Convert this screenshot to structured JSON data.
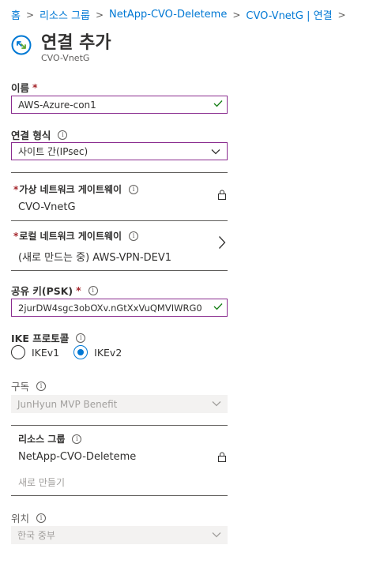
{
  "breadcrumb": [
    "홈",
    "리소스 그룹",
    "NetApp-CVO-Deleteme",
    "CVO-VnetG | 연결"
  ],
  "header": {
    "title": "연결 추가",
    "subtitle": "CVO-VnetG"
  },
  "form": {
    "name": {
      "label": "이름",
      "value": "AWS-Azure-con1"
    },
    "connection_type": {
      "label": "연결 형식",
      "value": "사이트 간(IPsec)"
    },
    "virtual_gateway": {
      "label": "가상 네트워크 게이트웨이",
      "value": "CVO-VnetG"
    },
    "local_gateway": {
      "label": "로컬 네트워크 게이트웨이",
      "value": "(새로 만드는 중) AWS-VPN-DEV1"
    },
    "psk": {
      "label": "공유 키(PSK)",
      "value": "2jurDW4sgc3obOXv.nGtXxVuQMVIWRG0"
    },
    "ike": {
      "label": "IKE 프로토콜",
      "options": [
        "IKEv1",
        "IKEv2"
      ],
      "selected": "IKEv2"
    },
    "subscription": {
      "label": "구독",
      "value": "JunHyun MVP Benefit"
    },
    "resource_group": {
      "label": "리소스 그룹",
      "value": "NetApp-CVO-Deleteme",
      "create_new": "새로 만들기"
    },
    "location": {
      "label": "위치",
      "value": "한국 중부"
    }
  },
  "colors": {
    "link": "#0078d4",
    "focus_border": "#8a2d8f",
    "required": "#a4262c",
    "valid_check": "#107c10"
  }
}
